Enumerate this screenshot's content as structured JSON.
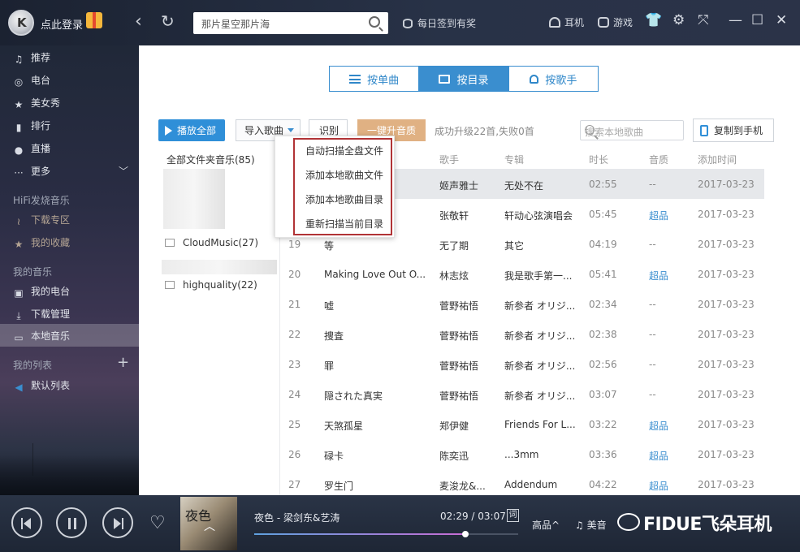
{
  "app": {
    "login_label": "点此登录",
    "search_placeholder": "那片星空那片海",
    "daily_signin": "每日签到有奖",
    "headphone_label": "耳机",
    "game_label": "游戏"
  },
  "sidebar": {
    "main_items": [
      {
        "label": "推荐",
        "icon": "music-note-icon"
      },
      {
        "label": "电台",
        "icon": "radio-icon"
      },
      {
        "label": "美女秀",
        "icon": "star-icon"
      },
      {
        "label": "排行",
        "icon": "chart-bars-icon"
      },
      {
        "label": "直播",
        "icon": "microphone-icon"
      },
      {
        "label": "更多",
        "icon": "more-dots-icon"
      }
    ],
    "hifi_section": "HiFi发烧音乐",
    "hifi_items": [
      {
        "label": "下载专区",
        "icon": "waveform-icon"
      },
      {
        "label": "我的收藏",
        "icon": "star-icon"
      }
    ],
    "my_music_section": "我的音乐",
    "my_music_items": [
      {
        "label": "我的电台",
        "icon": "radio-icon"
      },
      {
        "label": "下载管理",
        "icon": "download-icon"
      },
      {
        "label": "本地音乐",
        "icon": "monitor-icon"
      }
    ],
    "playlist_section": "我的列表",
    "playlist_items": [
      {
        "label": "默认列表",
        "icon": "speaker-icon"
      }
    ]
  },
  "view_tabs": [
    {
      "label": "按单曲",
      "active": false
    },
    {
      "label": "按目录",
      "active": true
    },
    {
      "label": "按歌手",
      "active": false
    }
  ],
  "toolbar": {
    "play_all": "播放全部",
    "import": "导入歌曲",
    "identify": "识别",
    "upgrade": "一键升音质",
    "upgrade_status": "成功升级22首,失败0首",
    "local_search_placeholder": "搜索本地歌曲",
    "copy_to_phone": "复制到手机"
  },
  "folders": {
    "all_label": "全部文件夹音乐(85)",
    "items": [
      "CloudMusic(27)",
      "highquality(22)"
    ]
  },
  "import_menu": {
    "items": [
      "自动扫描全盘文件",
      "添加本地歌曲文件",
      "添加本地歌曲目录",
      "重新扫描当前目录"
    ]
  },
  "table": {
    "headers": [
      "歌手",
      "专辑",
      "时长",
      "音质",
      "添加时间"
    ],
    "rows": [
      {
        "num": "",
        "title": "",
        "artist": "姬声雅士",
        "album": "无处不在",
        "duration": "02:55",
        "quality": "--",
        "added": "2017-03-23"
      },
      {
        "num": "",
        "title": "",
        "artist": "张敬轩",
        "album": "轩动心弦演唱会",
        "duration": "05:45",
        "quality": "超品",
        "added": "2017-03-23"
      },
      {
        "num": "19",
        "title": "等",
        "artist": "无了期",
        "album": "其它",
        "duration": "04:19",
        "quality": "--",
        "added": "2017-03-23"
      },
      {
        "num": "20",
        "title": "Making Love Out O...",
        "artist": "林志炫",
        "album": "我是歌手第一...",
        "duration": "05:41",
        "quality": "超品",
        "added": "2017-03-23"
      },
      {
        "num": "21",
        "title": "嘘",
        "artist": "菅野祐悟",
        "album": "新参者 オリジ...",
        "duration": "02:34",
        "quality": "--",
        "added": "2017-03-23"
      },
      {
        "num": "22",
        "title": "捜査",
        "artist": "菅野祐悟",
        "album": "新参者 オリジ...",
        "duration": "02:38",
        "quality": "--",
        "added": "2017-03-23"
      },
      {
        "num": "23",
        "title": "罪",
        "artist": "菅野祐悟",
        "album": "新参者 オリジ...",
        "duration": "02:56",
        "quality": "--",
        "added": "2017-03-23"
      },
      {
        "num": "24",
        "title": "隠された真実",
        "artist": "菅野祐悟",
        "album": "新参者 オリジ...",
        "duration": "03:07",
        "quality": "--",
        "added": "2017-03-23"
      },
      {
        "num": "25",
        "title": "天煞孤星",
        "artist": "郑伊健",
        "album": "Friends For L...",
        "duration": "03:22",
        "quality": "超品",
        "added": "2017-03-23"
      },
      {
        "num": "26",
        "title": "碌卡",
        "artist": "陈奕迅",
        "album": "...3mm",
        "duration": "03:36",
        "quality": "超品",
        "added": "2017-03-23"
      },
      {
        "num": "27",
        "title": "罗生门",
        "artist": "麦浚龙&...",
        "album": "Addendum",
        "duration": "04:22",
        "quality": "超品",
        "added": "2017-03-23"
      }
    ]
  },
  "player": {
    "song": "夜色 - 梁剑东&艺涛",
    "time": "02:29 / 03:07",
    "progress": 0.8,
    "lyric_label": "词",
    "quality": "高品^",
    "effect": "美音",
    "cover_text": "夜色"
  },
  "watermark": {
    "text": "FIDUE飞朵耳机"
  },
  "colors": {
    "accent": "#3a8ecf",
    "play_button": "#2f8fd8",
    "upgrade_button": "#e0b183",
    "menu_highlight_frame": "#b13336",
    "hq_text": "#3a8ecf"
  }
}
